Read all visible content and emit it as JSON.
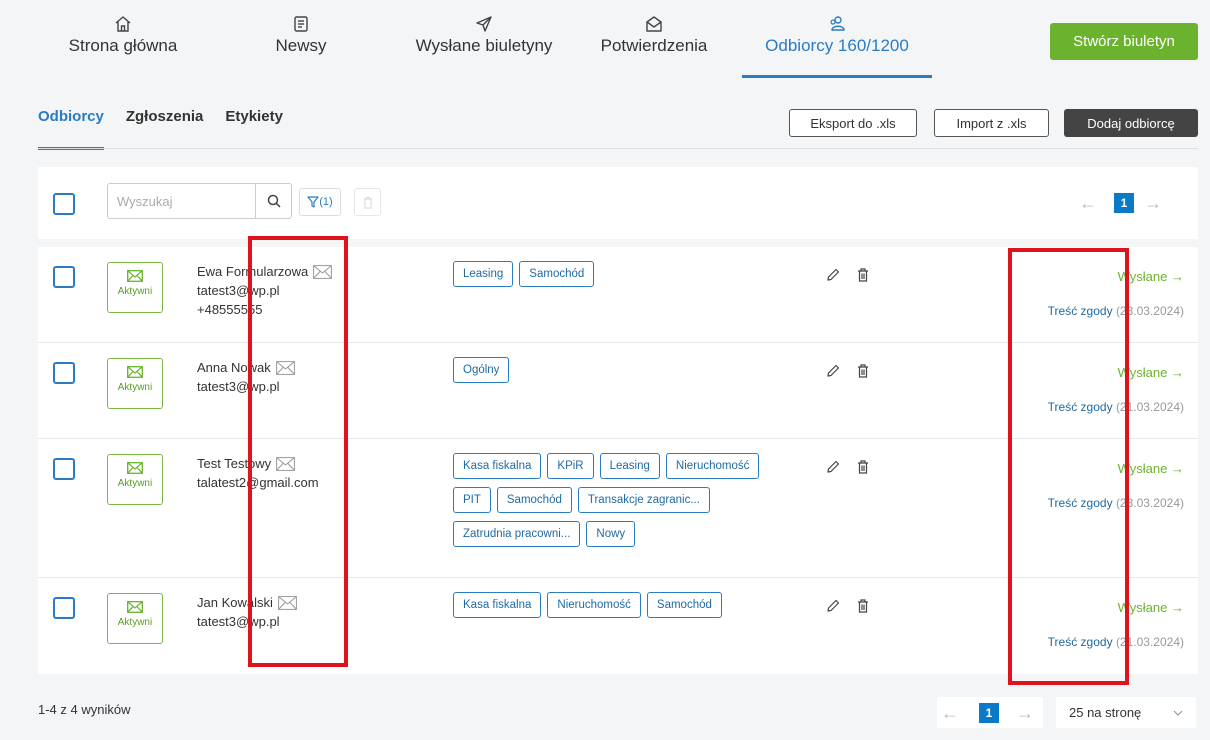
{
  "nav": {
    "items": [
      {
        "label": "Strona główna",
        "icon": "home-icon"
      },
      {
        "label": "Newsy",
        "icon": "news-icon"
      },
      {
        "label": "Wysłane biuletyny",
        "icon": "send-icon"
      },
      {
        "label": "Potwierdzenia",
        "icon": "open-envelope-icon"
      },
      {
        "label": "Odbiorcy 160/1200",
        "icon": "users-icon"
      }
    ],
    "create_label": "Stwórz biuletyn"
  },
  "subtabs": [
    "Odbiorcy",
    "Zgłoszenia",
    "Etykiety"
  ],
  "actions": {
    "export": "Eksport do .xls",
    "import": "Import z .xls",
    "add": "Dodaj odbiorcę"
  },
  "toolbar": {
    "search_placeholder": "Wyszukaj",
    "filter_count": "(1)",
    "page": "1"
  },
  "rows": [
    {
      "status": "Aktywni",
      "name": "Ewa Formularzowa",
      "email": "tatest3@wp.pl",
      "phone": "+48555555",
      "tags": [
        "Leasing",
        "Samochód"
      ],
      "sent": "Wysłane →",
      "consent": "Treść zgody",
      "consent_date": "(28.03.2024)"
    },
    {
      "status": "Aktywni",
      "name": "Anna Nowak",
      "email": "tatest3@wp.pl",
      "phone": "",
      "tags": [
        "Ogólny"
      ],
      "sent": "Wysłane →",
      "consent": "Treść zgody",
      "consent_date": "(21.03.2024)"
    },
    {
      "status": "Aktywni",
      "name": "Test Testowy",
      "email": "talatest2@gmail.com",
      "phone": "",
      "tags": [
        "Kasa fiskalna",
        "KPiR",
        "Leasing",
        "Nieruchomość",
        "PIT",
        "Samochód",
        "Transakcje zagranic...",
        "Zatrudnia pracowni...",
        "Nowy"
      ],
      "sent": "Wysłane →",
      "consent": "Treść zgody",
      "consent_date": "(28.03.2024)"
    },
    {
      "status": "Aktywni",
      "name": "Jan Kowalski",
      "email": "tatest3@wp.pl",
      "phone": "",
      "tags": [
        "Kasa fiskalna",
        "Nieruchomość",
        "Samochód"
      ],
      "sent": "Wysłane →",
      "consent": "Treść zgody",
      "consent_date": "(21.03.2024)"
    }
  ],
  "footer": {
    "results": "1-4 z 4 wyników",
    "page": "1",
    "per_page": "25 na stronę"
  },
  "colors": {
    "accent_blue": "#2a7cc4",
    "accent_green": "#6bb32e",
    "highlight_red": "#e0121c"
  }
}
